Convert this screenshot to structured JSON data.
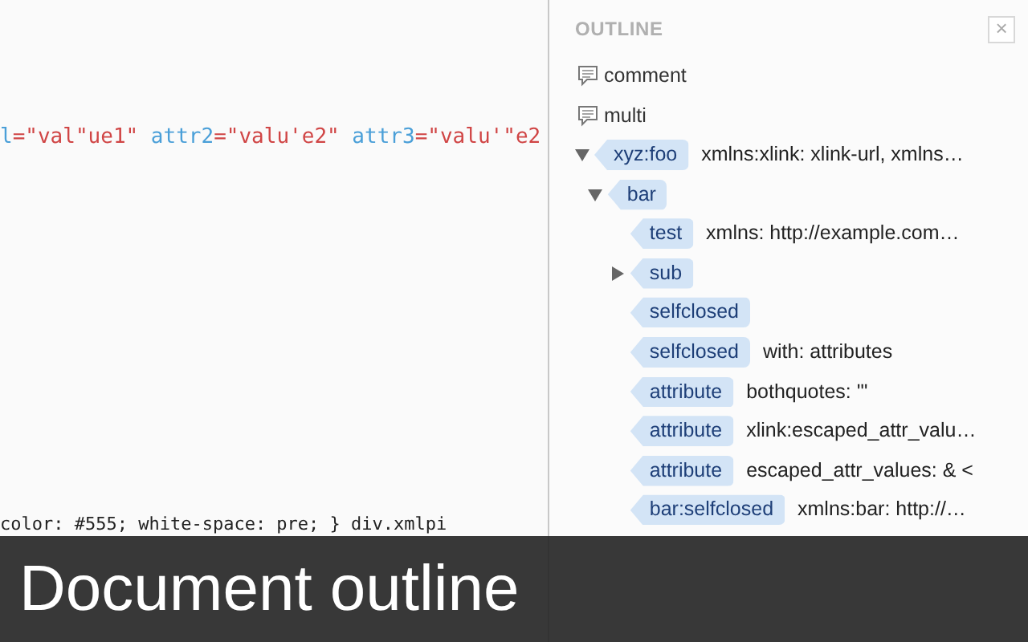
{
  "editor": {
    "attribute_line": [
      {
        "kind": "attr",
        "text": "l"
      },
      {
        "kind": "value",
        "text": "=\"val\"ue1\""
      },
      {
        "kind": "attr",
        "text": " attr2"
      },
      {
        "kind": "value",
        "text": "=\"valu'e2\""
      },
      {
        "kind": "attr",
        "text": " attr3"
      },
      {
        "kind": "value",
        "text": "=\"valu'\"e2"
      }
    ],
    "style_lines": [
      "color: #555; white-space: pre; } div.xmlpi"
    ]
  },
  "outline": {
    "title": "OUTLINE",
    "close": "×",
    "items": [
      {
        "kind": "comment",
        "label": "comment"
      },
      {
        "kind": "comment",
        "label": "multi"
      },
      {
        "kind": "tag",
        "label": "xyz:foo",
        "detail": "xmlns:xlink: xlink-url, xmlns…",
        "expanded": true,
        "children": [
          {
            "kind": "tag",
            "label": "bar",
            "expanded": true,
            "children": [
              {
                "kind": "tag",
                "label": "test",
                "detail": "xmlns: http://example.com…"
              },
              {
                "kind": "tag",
                "label": "sub",
                "expanded": false
              },
              {
                "kind": "tag",
                "label": "selfclosed"
              },
              {
                "kind": "tag",
                "label": "selfclosed",
                "detail": "with: attributes"
              },
              {
                "kind": "tag",
                "label": "attribute",
                "detail": "bothquotes: '\""
              },
              {
                "kind": "tag",
                "label": "attribute",
                "detail": "xlink:escaped_attr_valu…"
              },
              {
                "kind": "tag",
                "label": "attribute",
                "detail": "escaped_attr_values: & <"
              },
              {
                "kind": "tag",
                "label": "bar:selfclosed",
                "detail": "xmlns:bar: http://…"
              }
            ]
          }
        ]
      }
    ]
  },
  "caption": "Document outline"
}
